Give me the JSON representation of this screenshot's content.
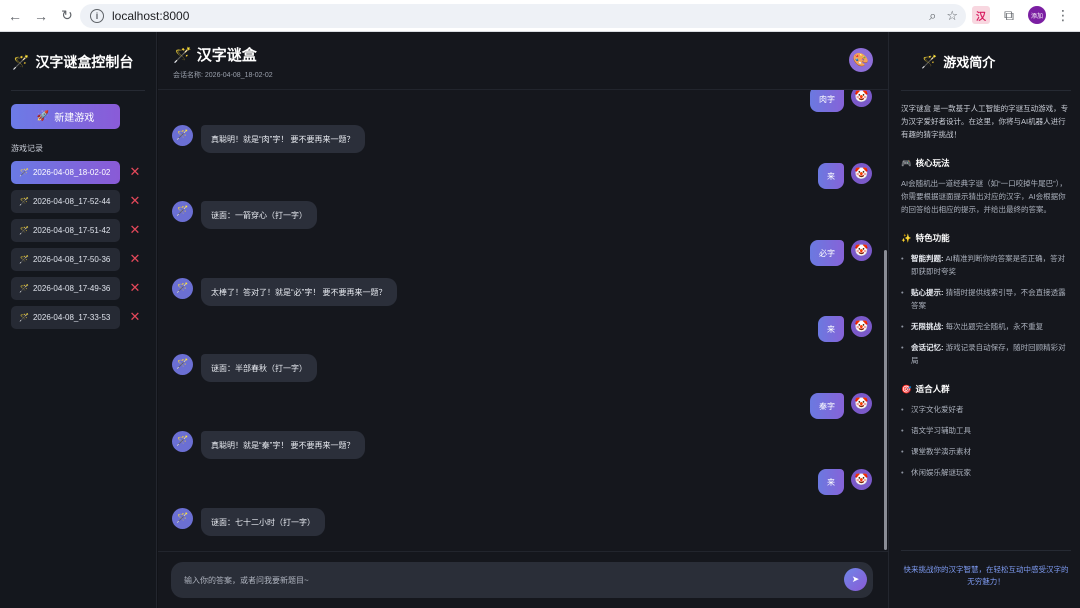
{
  "browser": {
    "url": "localhost:8000",
    "profile_initials": "添加"
  },
  "sidebar": {
    "title": "汉字谜盒控制台",
    "new_game_label": "新建游戏",
    "history_label": "游戏记录",
    "history": [
      {
        "label": "2026-04-08_18-02-02",
        "active": true
      },
      {
        "label": "2026-04-08_17-52-44",
        "active": false
      },
      {
        "label": "2026-04-08_17-51-42",
        "active": false
      },
      {
        "label": "2026-04-08_17-50-36",
        "active": false
      },
      {
        "label": "2026-04-08_17-49-36",
        "active": false
      },
      {
        "label": "2026-04-08_17-33-53",
        "active": false
      }
    ],
    "delete_glyph": "✕"
  },
  "main": {
    "title": "汉字谜盒",
    "session_prefix": "会话名称: ",
    "session_name": "2026-04-08_18-02-02",
    "messages": [
      {
        "role": "user",
        "text": "肉字"
      },
      {
        "role": "bot",
        "text": "真聪明！就是“肉”字！ 要不要再来一题？"
      },
      {
        "role": "user",
        "text": "来"
      },
      {
        "role": "bot",
        "text": "谜面：一箭穿心（打一字）"
      },
      {
        "role": "user",
        "text": "必字"
      },
      {
        "role": "bot",
        "text": "太棒了！答对了！就是“必”字！ 要不要再来一题？"
      },
      {
        "role": "user",
        "text": "来"
      },
      {
        "role": "bot",
        "text": "谜面：半部春秋（打一字）"
      },
      {
        "role": "user",
        "text": "秦字"
      },
      {
        "role": "bot",
        "text": "真聪明！就是“秦”字！ 要不要再来一题？"
      },
      {
        "role": "user",
        "text": "来"
      },
      {
        "role": "bot",
        "text": "谜面：七十二小时（打一字）"
      }
    ],
    "input_placeholder": "输入你的答案，或者问我要新题目~"
  },
  "about": {
    "title": "游戏简介",
    "intro": "汉字谜盒 是一款基于人工智能的字谜互动游戏，专为汉字爱好者设计。在这里，你将与AI机器人进行有趣的猜字挑战！",
    "core_title": "核心玩法",
    "core_text": "AI会随机出一道经典字谜（如“一口咬掉牛尾巴”），你需要根据谜面提示猜出对应的汉字，AI会根据你的回答给出相应的提示，并给出最终的答案。",
    "features_title": "特色功能",
    "features": [
      {
        "name": "智能判题:",
        "desc": "AI精准判断你的答案是否正确，答对即获即时夸奖"
      },
      {
        "name": "贴心提示:",
        "desc": "猜错时提供线索引导，不会直接透露答案"
      },
      {
        "name": "无限挑战:",
        "desc": "每次出题完全随机，永不重复"
      },
      {
        "name": "会话记忆:",
        "desc": "游戏记录自动保存，随时回顾精彩对局"
      }
    ],
    "audience_title": "适合人群",
    "audience": [
      "汉字文化爱好者",
      "语文学习辅助工具",
      "课堂教学演示素材",
      "休闲娱乐解谜玩家"
    ],
    "footer": "快来挑战你的汉字智慧，在轻松互动中感受汉字的无穷魅力！"
  },
  "icons": {
    "wand": "🪄",
    "rocket": "🚀",
    "palette": "🎨",
    "clown": "🤡",
    "game": "🎮",
    "sparkles": "✨",
    "target": "🎯",
    "send": "➤"
  }
}
